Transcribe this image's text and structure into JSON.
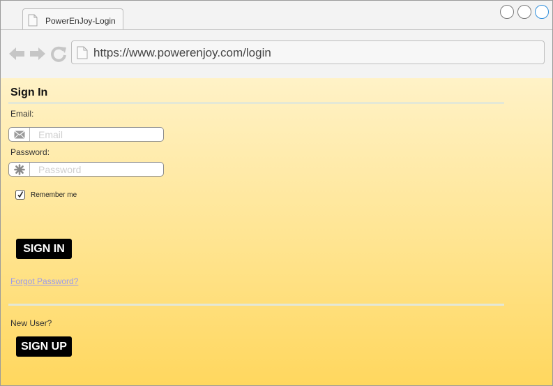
{
  "browser": {
    "tab": {
      "title": "PowerEnJoy-Login"
    },
    "address": {
      "url": "https://www.powerenjoy.com/login"
    }
  },
  "page": {
    "title": "Sign In",
    "email": {
      "label": "Email:",
      "placeholder": "Email",
      "value": ""
    },
    "password": {
      "label": "Password:",
      "placeholder": "Password",
      "value": ""
    },
    "remember": {
      "label": "Remember me",
      "checked": true
    },
    "signin_button": "SIGN IN",
    "forgot_link": "Forgot Password?",
    "new_user_label": "New User?",
    "signup_button": "SIGN UP"
  },
  "icons": {
    "tab": "page-icon",
    "back": "arrow-left-icon",
    "forward": "arrow-right-icon",
    "reload": "reload-icon",
    "address": "page-icon",
    "email": "envelope-icon",
    "password": "asterisk-icon",
    "checkbox": "checkmark-icon"
  },
  "colors": {
    "page_gradient_top": "#fff2c7",
    "page_gradient_bottom": "#ffd75e",
    "button_bg": "#000000",
    "link": "#9b9bea",
    "active_window_button": "#2f8fdc"
  }
}
